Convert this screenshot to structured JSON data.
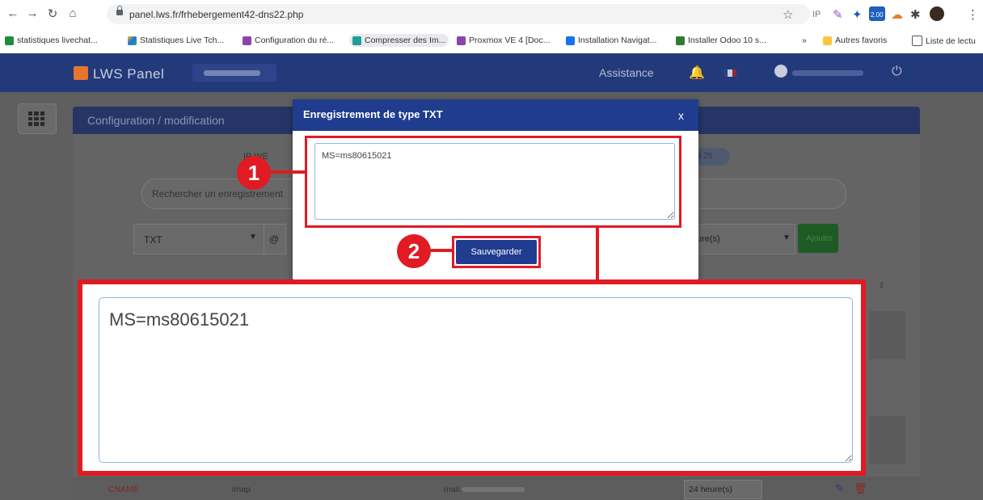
{
  "browser": {
    "url": "panel.lws.fr/frhebergement42-dns22.php",
    "bookmarks": [
      "statistiques livechat...",
      "Statistiques Live Tch...",
      "Configuration du ré...",
      "Compresser des Im...",
      "Proxmox VE 4 [Doc...",
      "Installation Navigat...",
      "Installer Odoo 10 s...",
      "»",
      "Autres favoris",
      "Liste de lectu"
    ],
    "ext_badge": "2.00"
  },
  "app": {
    "logo": "LWS Panel",
    "assistance": "Assistance"
  },
  "card": {
    "title": "Configuration / modification",
    "search_placeholder": "Rechercher un enregistrement",
    "ip_fragment_left": "IP WE",
    "ip_fragment_right": "9.25",
    "type_select": "TXT",
    "at_symbol": "@",
    "ttl_select": "ure(s)",
    "add_button": "Ajouter"
  },
  "bottom_row": {
    "type": "CNAME",
    "name": "imap",
    "target": "mail.",
    "ttl": "24 heure(s)"
  },
  "modal": {
    "title": "Enregistrement de type TXT",
    "close": "x",
    "textarea_value": "MS=ms80615021",
    "save_button": "Sauvegarder"
  },
  "annotations": {
    "step1": "1",
    "step2": "2",
    "color": "#e01b24"
  },
  "zoom": {
    "textarea_value": "MS=ms80615021"
  }
}
